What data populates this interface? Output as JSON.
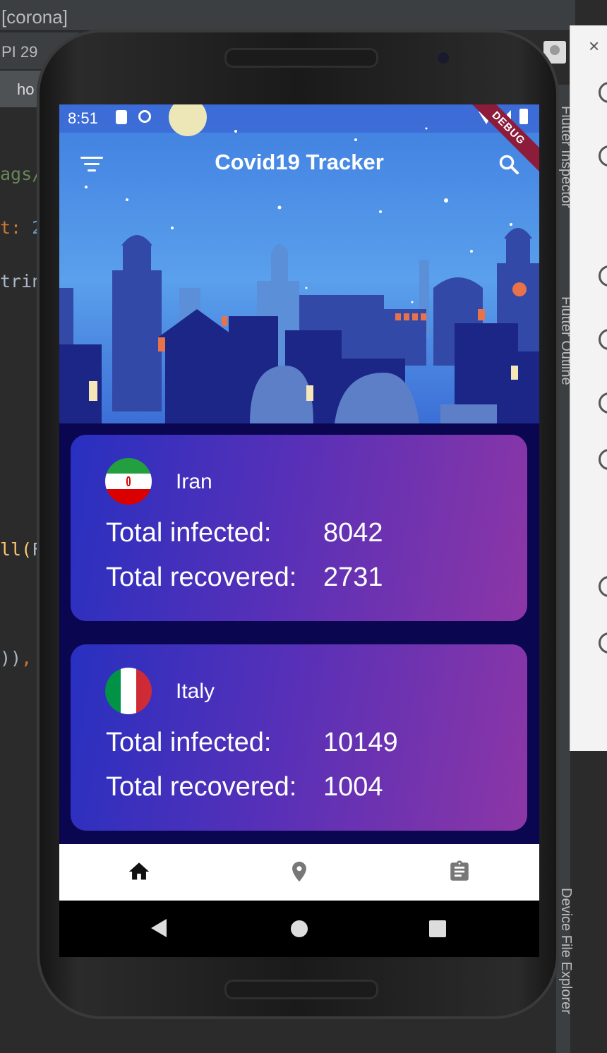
{
  "ide": {
    "window_title": "[corona]",
    "device_selector": "PI 29",
    "file_tab": "ho",
    "code_fragments": [
      "ags/",
      "t: ",
      "2",
      "trin",
      "ll(",
      "F",
      "))",
      ","
    ],
    "side_panels": [
      "Flutter Inspector",
      "Flutter Outline",
      "Device File Explorer"
    ],
    "emulator_panel_close": "×"
  },
  "device": {
    "status_bar": {
      "time": "8:51"
    },
    "debug_banner": "DEBUG"
  },
  "app": {
    "title": "Covid19 Tracker",
    "icons": {
      "menu": "filter-menu-icon",
      "search": "search-icon"
    },
    "countries": [
      {
        "name": "Iran",
        "flag": "iran-flag-icon",
        "infected_label": "Total infected:",
        "infected": "8042",
        "recovered_label": "Total recovered:",
        "recovered": "2731"
      },
      {
        "name": "Italy",
        "flag": "italy-flag-icon",
        "infected_label": "Total infected:",
        "infected": "10149",
        "recovered_label": "Total recovered:",
        "recovered": "1004"
      }
    ],
    "bottom_nav": [
      {
        "icon": "home-icon",
        "active": true
      },
      {
        "icon": "location-pin-icon",
        "active": false
      },
      {
        "icon": "clipboard-icon",
        "active": false
      }
    ],
    "colors": {
      "card_gradient_start": "#2830c0",
      "card_gradient_end": "#8c36a6",
      "screen_background": "#0a0650",
      "sky_top": "#3f7ee0",
      "nav_active": "#111111",
      "nav_inactive": "#777777"
    }
  }
}
